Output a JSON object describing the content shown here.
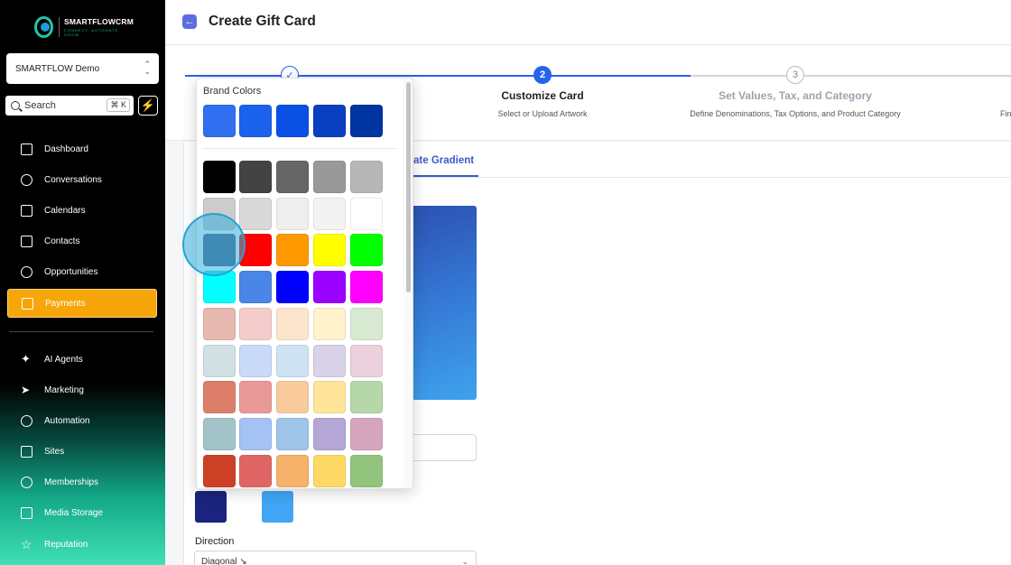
{
  "brand": {
    "name": "SMARTFLOWCRM",
    "tagline": "CONNECT. AUTOMATE. GROW."
  },
  "account": {
    "name": "SMARTFLOW Demo"
  },
  "search": {
    "label": "Search",
    "shortcut": "⌘ K"
  },
  "sidebar": {
    "items": [
      {
        "label": "Dashboard",
        "icon": "dashboard-icon"
      },
      {
        "label": "Conversations",
        "icon": "chat-icon"
      },
      {
        "label": "Calendars",
        "icon": "calendar-icon"
      },
      {
        "label": "Contacts",
        "icon": "contacts-icon"
      },
      {
        "label": "Opportunities",
        "icon": "opportunities-icon"
      },
      {
        "label": "Payments",
        "icon": "payments-icon",
        "active": true
      },
      {
        "label": "AI Agents",
        "icon": "ai-agents-icon"
      },
      {
        "label": "Marketing",
        "icon": "send-icon"
      },
      {
        "label": "Automation",
        "icon": "automation-icon"
      },
      {
        "label": "Sites",
        "icon": "sites-icon"
      },
      {
        "label": "Memberships",
        "icon": "award-icon"
      },
      {
        "label": "Media Storage",
        "icon": "image-icon"
      },
      {
        "label": "Reputation",
        "icon": "star-icon"
      }
    ]
  },
  "header": {
    "title": "Create Gift Card"
  },
  "stepper": {
    "steps": [
      {
        "number": "",
        "title": "",
        "subtitle": "",
        "state": "done"
      },
      {
        "number": "2",
        "title": "Customize Card",
        "subtitle": "Select or Upload Artwork",
        "state": "current"
      },
      {
        "number": "3",
        "title": "Set Values, Tax, and Category",
        "subtitle": "Define Denominations, Tax Options, and Product Category",
        "state": "upcoming"
      },
      {
        "number": "",
        "title": "",
        "subtitle": "Fin",
        "state": "upcoming"
      }
    ]
  },
  "tabs": {
    "gradient_label": "ate Gradient"
  },
  "direction": {
    "label": "Direction",
    "value": "Diagonal ↘"
  },
  "picker": {
    "title": "Brand Colors",
    "brand_colors": [
      "#2f6ff0",
      "#1a62ec",
      "#0b50e4",
      "#0a3fc2",
      "#0034a0"
    ],
    "palette_rows": [
      [
        "#000000",
        "#434343",
        "#666666",
        "#999999",
        "#b7b7b7"
      ],
      [
        "#cccccc",
        "#d9d9d9",
        "#efefef",
        "#f3f3f3",
        "#ffffff"
      ],
      [
        "#4a5f86",
        "#ff0000",
        "#ff9900",
        "#ffff00",
        "#00ff00"
      ],
      [
        "#00ffff",
        "#4a86e8",
        "#0000ff",
        "#9900ff",
        "#ff00ff"
      ],
      [
        "#e6b8af",
        "#f4cccc",
        "#fce5cd",
        "#fff2cc",
        "#d9ead3"
      ],
      [
        "#d0e0e3",
        "#c9daf8",
        "#cfe2f3",
        "#d9d2e9",
        "#ead1dc"
      ],
      [
        "#dd7e6b",
        "#ea9999",
        "#f9cb9c",
        "#ffe599",
        "#b6d7a8"
      ],
      [
        "#a2c4c9",
        "#a4c2f4",
        "#9fc5e8",
        "#b4a7d6",
        "#d5a6bd"
      ],
      [
        "#cc4125",
        "#e06666",
        "#f6b26b",
        "#ffd966",
        "#93c47d"
      ]
    ]
  },
  "gradient_stops": {
    "start": "#1a237e",
    "end": "#42a5f5"
  },
  "colors": {
    "accent": "#2563eb",
    "active_nav": "#f7a60a"
  }
}
